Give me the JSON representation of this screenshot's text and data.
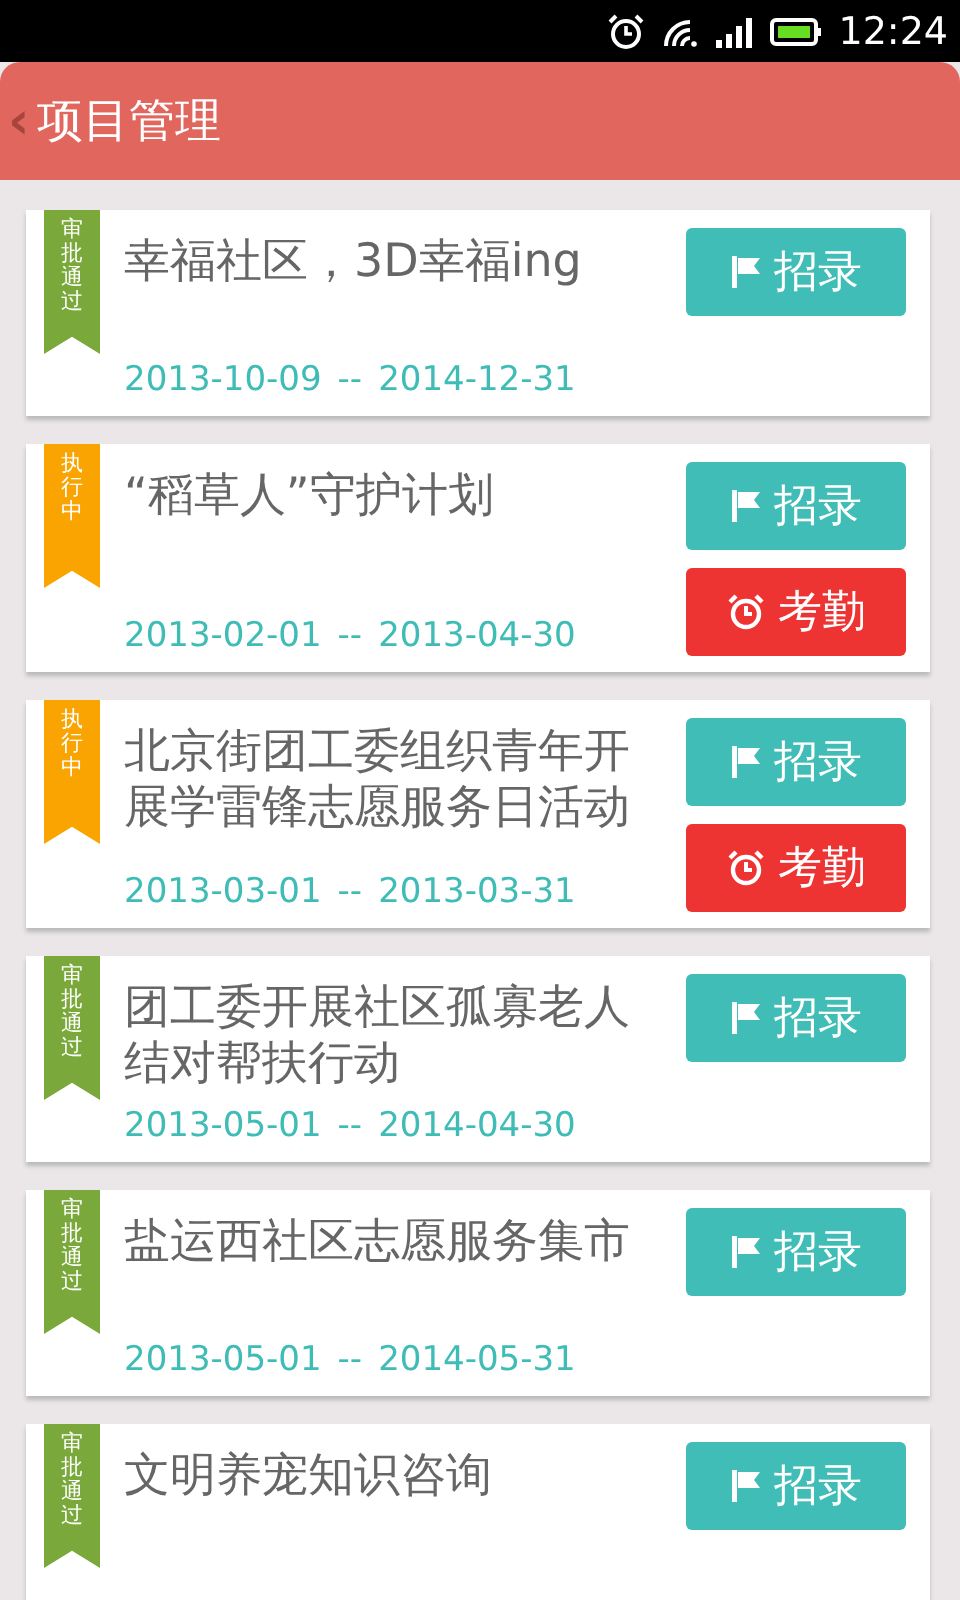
{
  "status_bar": {
    "time": "12:24"
  },
  "header": {
    "back": "‹",
    "title": "项目管理"
  },
  "projects": [
    {
      "kind": "approved",
      "ribbon": "审批通过",
      "title": "幸福社区，3D幸福ing",
      "start": "2013-10-09",
      "sep": "--",
      "end": "2014-12-31",
      "buttons": [
        {
          "kind": "recruit",
          "label": "招录"
        }
      ]
    },
    {
      "kind": "running",
      "ribbon": "执行中",
      "title": "“稻草人”守护计划",
      "start": "2013-02-01",
      "sep": "--",
      "end": "2013-04-30",
      "buttons": [
        {
          "kind": "recruit",
          "label": "招录"
        },
        {
          "kind": "attendance",
          "label": "考勤"
        }
      ]
    },
    {
      "kind": "running",
      "ribbon": "执行中",
      "title": "北京街团工委组织青年开展学雷锋志愿服务日活动",
      "start": "2013-03-01",
      "sep": "--",
      "end": "2013-03-31",
      "buttons": [
        {
          "kind": "recruit",
          "label": "招录"
        },
        {
          "kind": "attendance",
          "label": "考勤"
        }
      ]
    },
    {
      "kind": "approved",
      "ribbon": "审批通过",
      "title": "团工委开展社区孤寡老人结对帮扶行动",
      "start": "2013-05-01",
      "sep": "--",
      "end": "2014-04-30",
      "buttons": [
        {
          "kind": "recruit",
          "label": "招录"
        }
      ]
    },
    {
      "kind": "approved",
      "ribbon": "审批通过",
      "title": "盐运西社区志愿服务集市",
      "start": "2013-05-01",
      "sep": "--",
      "end": "2014-05-31",
      "buttons": [
        {
          "kind": "recruit",
          "label": "招录"
        }
      ]
    },
    {
      "kind": "approved",
      "ribbon": "审批通过",
      "title": "文明养宠知识咨询",
      "buttons": [
        {
          "kind": "recruit",
          "label": "招录"
        }
      ]
    }
  ]
}
